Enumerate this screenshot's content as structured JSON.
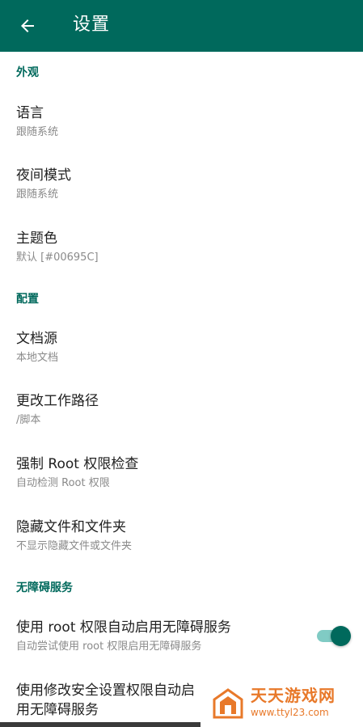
{
  "appbar": {
    "title": "设置",
    "back_icon": "arrow-back-icon"
  },
  "sections": {
    "appearance": {
      "header": "外观",
      "language": {
        "title": "语言",
        "summary": "跟随系统"
      },
      "night_mode": {
        "title": "夜间模式",
        "summary": "跟随系统"
      },
      "theme_color": {
        "title": "主题色",
        "summary": "默认 [#00695C]"
      }
    },
    "config": {
      "header": "配置",
      "doc_source": {
        "title": "文档源",
        "summary": "本地文档"
      },
      "work_path": {
        "title": "更改工作路径",
        "summary": "/脚本"
      },
      "root_check": {
        "title": "强制 Root 权限检查",
        "summary": "自动检测 Root 权限"
      },
      "hidden_files": {
        "title": "隐藏文件和文件夹",
        "summary": "不显示隐藏文件或文件夹"
      }
    },
    "accessibility": {
      "header": "无障碍服务",
      "root_auto": {
        "title": "使用 root 权限自动启用无障碍服务",
        "summary": "自动尝试使用 root 权限启用无障碍服务",
        "enabled": true
      },
      "secure_settings": {
        "title": "使用修改安全设置权限自动启用无障碍服务"
      }
    }
  },
  "watermark": {
    "name": "天天游戏网",
    "url": "www.ttyl23.com"
  },
  "colors": {
    "primary": "#00695C",
    "switch_track": "#80CBC4",
    "watermark": "#E8792A"
  }
}
